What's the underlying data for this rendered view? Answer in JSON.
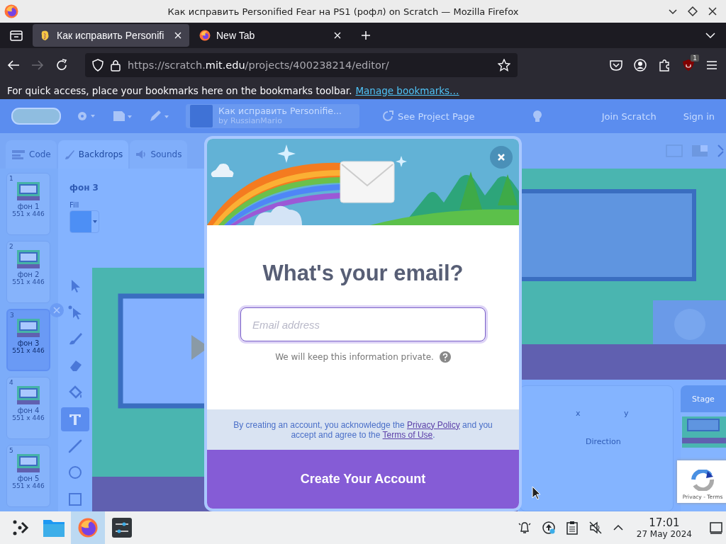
{
  "window": {
    "title": "Как исправить Personified Fear на PS1 (рофл) on Scratch — Mozilla Firefox"
  },
  "tabs": [
    {
      "kind": "scratch",
      "title": "Как исправить Personifi",
      "selected": true
    },
    {
      "kind": "firefox",
      "title": "New Tab",
      "selected": false
    }
  ],
  "navigation": {
    "back_disabled": false,
    "forward_disabled": true,
    "url": "https://scratch.**mit.edu**/projects/400238214/editor/",
    "extension_badge": "1"
  },
  "bookmarks_bar": {
    "message": "For quick access, place your bookmarks here on the bookmarks toolbar.",
    "link": "Manage bookmarks…"
  },
  "scratch_menu": {
    "project_title": "Как исправить Personifie...",
    "author": "by RussianMario",
    "see_project_page": "See Project Page",
    "join": "Join Scratch",
    "sign_in": "Sign in"
  },
  "editor_tabs": [
    {
      "kind": "code",
      "label": "Code",
      "selected": false
    },
    {
      "kind": "brush",
      "label": "Backdrops",
      "selected": true
    },
    {
      "kind": "sound",
      "label": "Sounds",
      "selected": false
    }
  ],
  "backdrops": [
    {
      "number": "1",
      "name": "фон 1",
      "size": "551 x 446",
      "selected": false
    },
    {
      "number": "2",
      "name": "фон 2",
      "size": "551 x 446",
      "selected": false
    },
    {
      "number": "3",
      "name": "фон 3",
      "size": "551 x 446",
      "selected": true
    },
    {
      "number": "4",
      "name": "фон 4",
      "size": "551 x 446",
      "selected": false
    },
    {
      "number": "5",
      "name": "фон 5",
      "size": "551 x 446",
      "selected": false
    }
  ],
  "paint_editor": {
    "costume_name": "фон 3",
    "fill_label": "Fill",
    "tools": [
      {
        "kind": "select",
        "selected": false
      },
      {
        "kind": "reshape",
        "selected": false
      },
      {
        "kind": "brush",
        "selected": false
      },
      {
        "kind": "eraser",
        "selected": false
      },
      {
        "kind": "fill",
        "selected": false
      },
      {
        "kind": "text",
        "selected": true
      },
      {
        "kind": "line",
        "selected": false
      },
      {
        "kind": "circle",
        "selected": false
      },
      {
        "kind": "rect",
        "selected": false
      }
    ]
  },
  "sprite_info": {
    "x_label": "x",
    "y_label": "y",
    "direction_label": "Direction"
  },
  "stage_panel": {
    "title": "Stage"
  },
  "recaptcha": {
    "text": "Privacy - Terms"
  },
  "modal": {
    "title": "What's your email?",
    "email_field": {
      "placeholder": "Email address"
    },
    "privacy_note": "We will keep this information private.",
    "legal": [
      {
        "text": "By creating an account, you acknowledge the ",
        "link": false
      },
      {
        "text": "Privacy Policy",
        "link": true
      },
      {
        "text": " and you accept and agree to the ",
        "link": false
      },
      {
        "text": "Terms of Use",
        "link": true
      },
      {
        "text": ".",
        "link": false
      }
    ],
    "button": "Create Your Account"
  },
  "taskbar": {
    "apps": [
      {
        "kind": "launcher",
        "selected": false
      },
      {
        "kind": "files",
        "selected": false
      },
      {
        "kind": "firefox",
        "selected": true
      },
      {
        "kind": "mixer",
        "selected": false
      }
    ],
    "tray": [
      {
        "kind": "bell"
      },
      {
        "kind": "update"
      },
      {
        "kind": "clipboard"
      },
      {
        "kind": "muted"
      },
      {
        "kind": "chevron"
      }
    ],
    "time": "17:01",
    "date": "27 May 2024"
  }
}
